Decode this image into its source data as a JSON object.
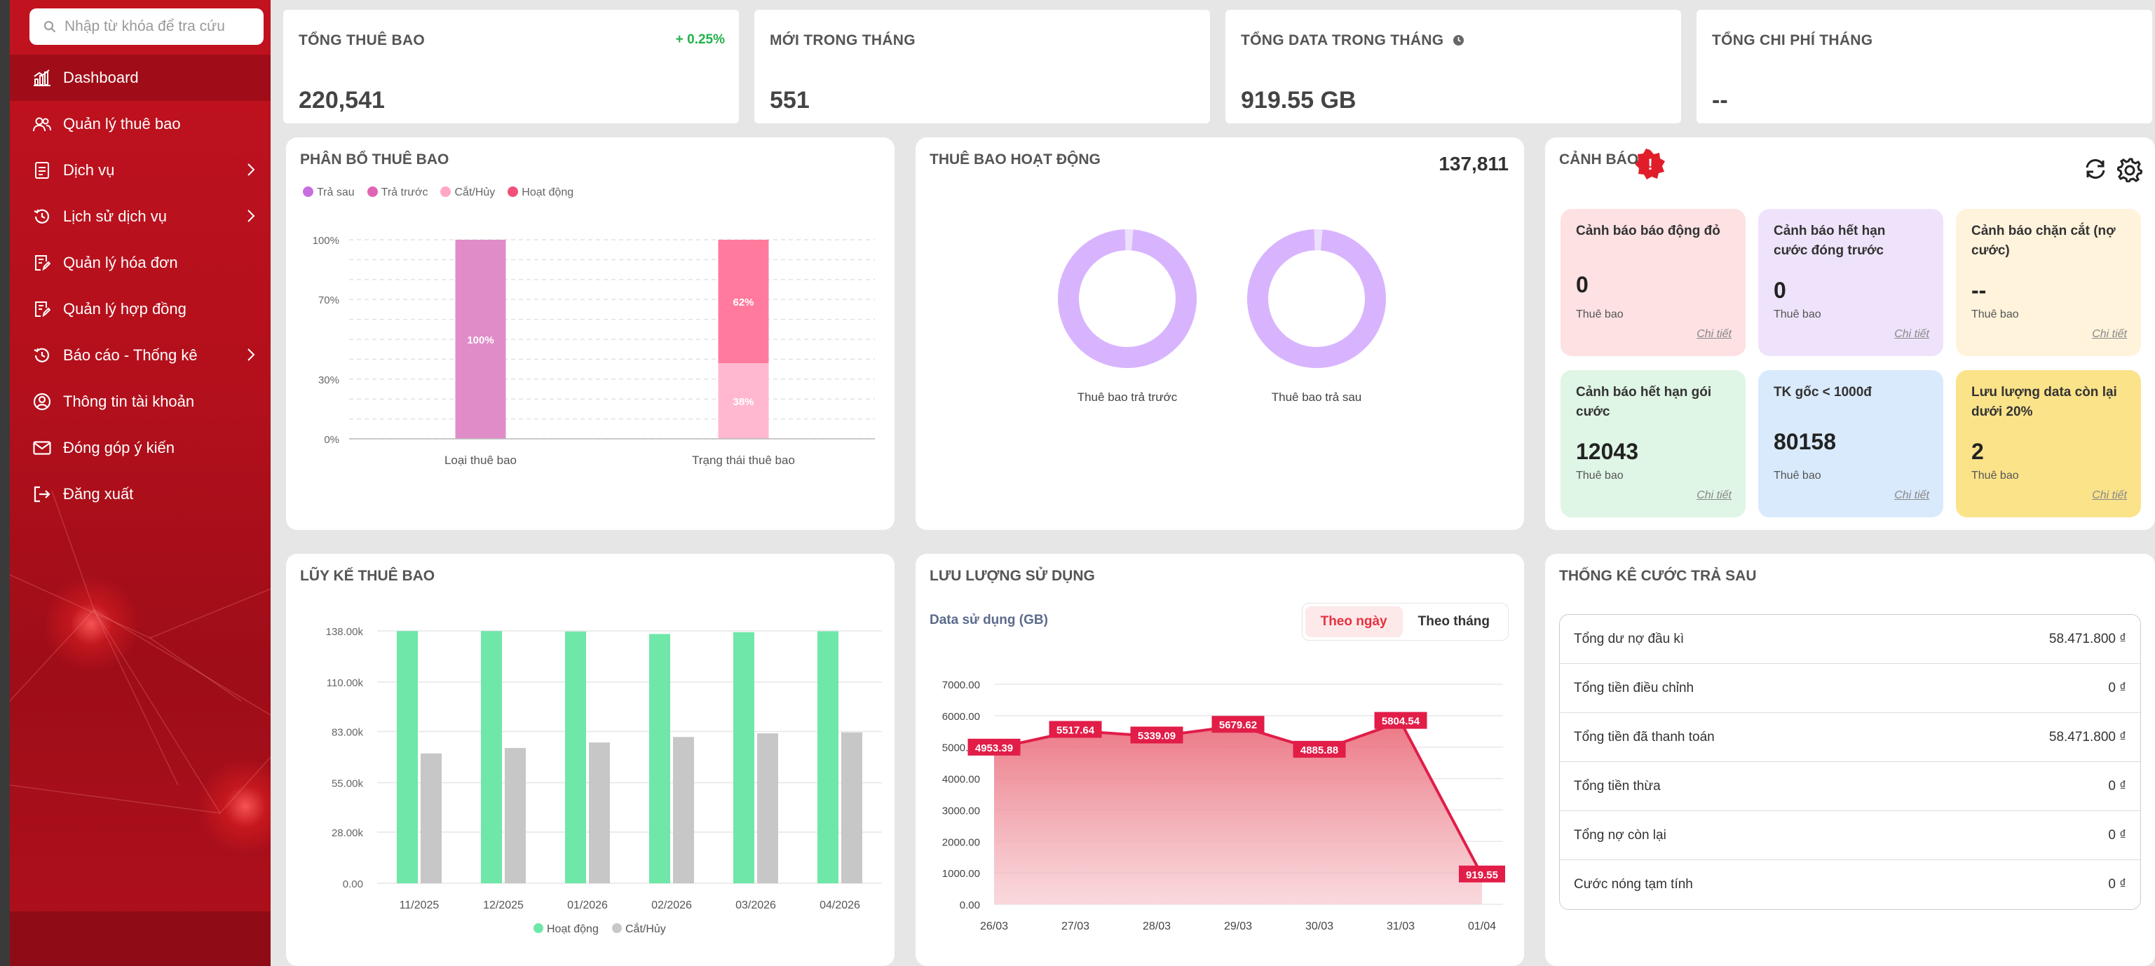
{
  "search": {
    "placeholder": "Nhập từ khóa để tra cứu"
  },
  "sidebar": {
    "items": [
      {
        "label": "Dashboard",
        "icon": "chart-icon"
      },
      {
        "label": "Quản lý thuê bao",
        "icon": "users-icon"
      },
      {
        "label": "Dịch vụ",
        "icon": "document-icon"
      },
      {
        "label": "Lịch sử dịch vụ",
        "icon": "history-icon"
      },
      {
        "label": "Quản lý hóa đơn",
        "icon": "edit-doc-icon"
      },
      {
        "label": "Quản lý hợp đồng",
        "icon": "edit-doc-icon"
      },
      {
        "label": "Báo cáo - Thống kê",
        "icon": "history-icon"
      },
      {
        "label": "Thông tin tài khoản",
        "icon": "user-circle-icon"
      },
      {
        "label": "Đóng góp ý kiến",
        "icon": "mail-icon"
      },
      {
        "label": "Đăng xuất",
        "icon": "logout-icon"
      }
    ]
  },
  "kpis": [
    {
      "title": "TỔNG THUÊ BAO",
      "value": "220,541",
      "delta": "+ 0.25%"
    },
    {
      "title": "MỚI TRONG THÁNG",
      "value": "551"
    },
    {
      "title": "TỔNG DATA TRONG THÁNG",
      "value": "919.55 GB"
    },
    {
      "title": "TỔNG CHI PHÍ THÁNG",
      "value": "--"
    }
  ],
  "distribution": {
    "title": "PHÂN BỔ THUÊ BAO",
    "legend": [
      "Trả sau",
      "Trả trước",
      "Cắt/Hủy",
      "Hoạt động"
    ],
    "colors": {
      "tra_sau": "#c86fe0",
      "tra_truoc": "#e064b4",
      "cat_huy": "#ffa7c4",
      "hoat_dong": "#f0507a"
    }
  },
  "active": {
    "title": "THUÊ BAO HOẠT ĐỘNG",
    "value": "137,811",
    "donut1": "Thuê bao trả trước",
    "donut2": "Thuê bao trả sau"
  },
  "alerts": {
    "title": "CẢNH BÁO",
    "badge": "!",
    "link": "Chi tiết",
    "unit": "Thuê bao",
    "items": [
      {
        "title": "Cảnh báo báo động đỏ",
        "value": "0",
        "bg": "#fde1e3"
      },
      {
        "title": "Cảnh báo hết hạn cước đóng trước",
        "value": "0",
        "bg": "#efe3fb"
      },
      {
        "title": "Cảnh báo chặn cắt (nợ cước)",
        "value": "--",
        "bg": "#fff3dc"
      },
      {
        "title": "Cảnh báo hết hạn gói cước",
        "value": "12043",
        "bg": "#dff5e5"
      },
      {
        "title": "TK gốc < 1000đ",
        "value": "80158",
        "bg": "#d9eafc"
      },
      {
        "title": "Lưu lượng data còn lại dưới 20%",
        "value": "2",
        "bg": "#fbe38a"
      }
    ]
  },
  "cumulative": {
    "title": "LŨY KẾ THUÊ BAO"
  },
  "usage": {
    "title": "LƯU LƯỢNG SỬ DỤNG",
    "subtitle": "Data sử dụng (GB)",
    "toggle_day": "Theo ngày",
    "toggle_month": "Theo tháng"
  },
  "postpaid": {
    "title": "THỐNG KÊ CƯỚC TRẢ SAU",
    "rows": [
      {
        "label": "Tổng dư nợ đầu kì",
        "value": "58.471.800 ₫"
      },
      {
        "label": "Tổng tiền điều chỉnh",
        "value": "0 ₫"
      },
      {
        "label": "Tổng tiền đã thanh toán",
        "value": "58.471.800 ₫"
      },
      {
        "label": "Tổng tiền thừa",
        "value": "0 ₫"
      },
      {
        "label": "Tổng nợ còn lại",
        "value": "0 ₫"
      },
      {
        "label": "Cước nóng tạm tính",
        "value": "0 ₫"
      }
    ]
  },
  "chart_data": [
    {
      "type": "bar",
      "title": "PHÂN BỔ THUÊ BAO",
      "categories": [
        "Loại thuê bao",
        "Trạng thái thuê bao"
      ],
      "ytick_labels": [
        "0%",
        "30%",
        "70%",
        "100%"
      ],
      "ylim": [
        0,
        100
      ],
      "stacked": true,
      "series": [
        {
          "name": "Trả trước",
          "values": [
            100,
            0
          ],
          "label": "100%"
        },
        {
          "name": "Cắt/Hủy",
          "values": [
            0,
            38
          ],
          "label": "38%"
        },
        {
          "name": "Hoạt động",
          "values": [
            0,
            62
          ],
          "label": "62%"
        }
      ],
      "legend": "top-left"
    },
    {
      "type": "pie",
      "title": "THUÊ BAO HOẠT ĐỘNG",
      "donuts": [
        {
          "label": "Thuê bao trả trước",
          "main_pct": 98,
          "color": "#d8b4fe"
        },
        {
          "label": "Thuê bao trả sau",
          "main_pct": 98,
          "color": "#d8b4fe"
        }
      ]
    },
    {
      "type": "bar",
      "title": "LŨY KẾ THUÊ BAO",
      "categories": [
        "11/2025",
        "12/2025",
        "01/2026",
        "02/2026",
        "03/2026",
        "04/2026"
      ],
      "ytick_labels": [
        "0.00",
        "28.00k",
        "55.00k",
        "83.00k",
        "110.00k",
        "138.00k"
      ],
      "ylim": [
        0,
        138000
      ],
      "series": [
        {
          "name": "Hoạt động",
          "values": [
            137900,
            137900,
            137700,
            136300,
            137300,
            137800
          ],
          "color": "#6ee7a8"
        },
        {
          "name": "Cắt/Hủy",
          "values": [
            71000,
            74000,
            77000,
            80000,
            82000,
            82500
          ],
          "color": "#c7c7c7"
        }
      ],
      "legend": "bottom"
    },
    {
      "type": "area",
      "title": "LƯU LƯỢNG SỬ DỤNG",
      "ylabel": "Data sử dụng (GB)",
      "x": [
        "26/03",
        "27/03",
        "28/03",
        "29/03",
        "30/03",
        "31/03",
        "01/04"
      ],
      "values": [
        4953.39,
        5517.64,
        5339.09,
        5679.62,
        4885.88,
        5804.54,
        919.55
      ],
      "labels": [
        "4953.39",
        "5517.64",
        "5339.09",
        "5679.62",
        "4885.88",
        "5804.54",
        "919.55"
      ],
      "ytick_labels": [
        "0.00",
        "1000.00",
        "2000.00",
        "3000.00",
        "4000.00",
        "5000.00",
        "6000.00",
        "7000.00"
      ],
      "ylim": [
        0,
        7000
      ],
      "color": "#e11d48"
    }
  ]
}
